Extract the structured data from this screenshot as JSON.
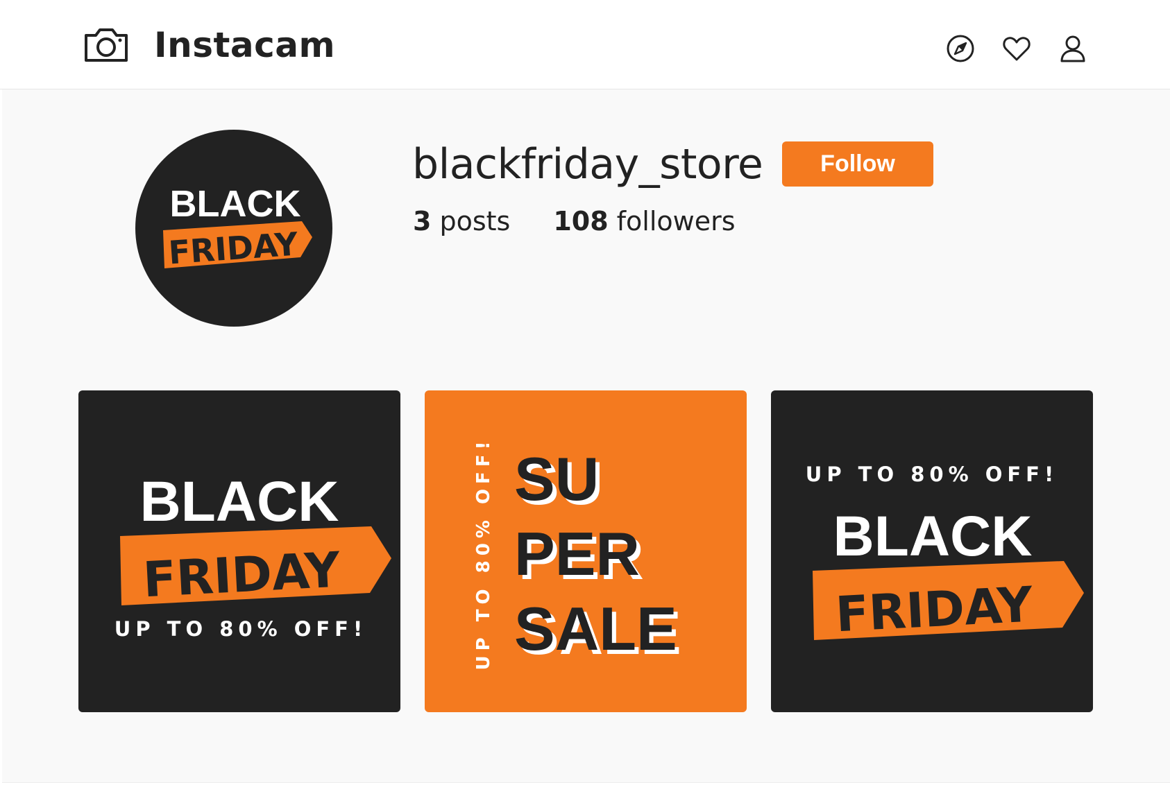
{
  "app": {
    "name": "Instacam",
    "icons": {
      "logo": "camera-icon",
      "explore": "compass-icon",
      "activity": "heart-icon",
      "profile": "user-icon"
    }
  },
  "profile": {
    "username": "blackfriday_store",
    "follow_label": "Follow",
    "posts_count": "3",
    "posts_label": "posts",
    "followers_count": "108",
    "followers_label": "followers",
    "avatar": {
      "line1": "BLACK",
      "line2": "FRIDAY"
    }
  },
  "posts": [
    {
      "line1": "BLACK",
      "line2": "FRIDAY",
      "tagline": "UP TO 80% OFF!"
    },
    {
      "line1": "SU",
      "line2": "PER",
      "line3": "SALE",
      "tagline": "UP TO 80% OFF!"
    },
    {
      "tagline": "UP TO 80% OFF!",
      "line1": "BLACK",
      "line2": "FRIDAY"
    }
  ],
  "colors": {
    "accent": "#f47a1f",
    "dark": "#222222",
    "background": "#f9f9f9"
  }
}
